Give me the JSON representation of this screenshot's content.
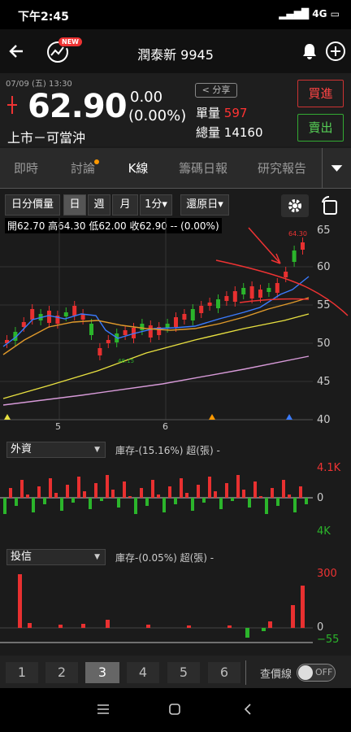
{
  "status": {
    "time": "下午2:45",
    "signal": "4G"
  },
  "header": {
    "title": "潤泰新 9945",
    "new_badge": "NEW"
  },
  "quote": {
    "datetime": "07/09 (五) 13:30",
    "price": "62.90",
    "change": "0.00",
    "change_pct": "(0.00%)",
    "market": "上市－可當沖",
    "share": "分享",
    "unit_vol_label": "單量",
    "unit_vol": "597",
    "total_vol_label": "總量",
    "total_vol": "14160",
    "buy": "買進",
    "sell": "賣出"
  },
  "tabs": [
    "即時",
    "討論",
    "K線",
    "籌碼日報",
    "研究報告"
  ],
  "toolbar": {
    "vol": "日分價量",
    "day": "日",
    "week": "週",
    "month": "月",
    "min": "1分▾",
    "restore": "還原日▾"
  },
  "ohlc": "開62.70 高64.30 低62.00 收62.90 -- (0.00%)",
  "price_axis": [
    "65",
    "60",
    "55",
    "50",
    "45",
    "40"
  ],
  "high_label": "64.30",
  "low_label": "48.15",
  "date_labels": [
    "5",
    "6"
  ],
  "foreign": {
    "label": "外資",
    "inventory": "庫存-(15.16%) 超(張) -",
    "top": "4.1K",
    "zero": "0",
    "bottom": "4K"
  },
  "trust": {
    "label": "投信",
    "inventory": "庫存-(0.05%) 超(張) -",
    "top": "300",
    "zero": "0",
    "bottom": "−55"
  },
  "pages": [
    "1",
    "2",
    "3",
    "4",
    "5",
    "6"
  ],
  "price_line_label": "查價線",
  "toggle": "OFF",
  "colors": {
    "up": "#e83030",
    "down": "#2bb52b",
    "ma5": "#3a7bff",
    "ma10": "#e09a2b",
    "ma20": "#e8e040",
    "ma60": "#d79ad8"
  },
  "chart_data": {
    "type": "candlestick",
    "price_axis": [
      40,
      65
    ],
    "last": {
      "open": 62.7,
      "high": 64.3,
      "low": 62.0,
      "close": 62.9
    }
  }
}
